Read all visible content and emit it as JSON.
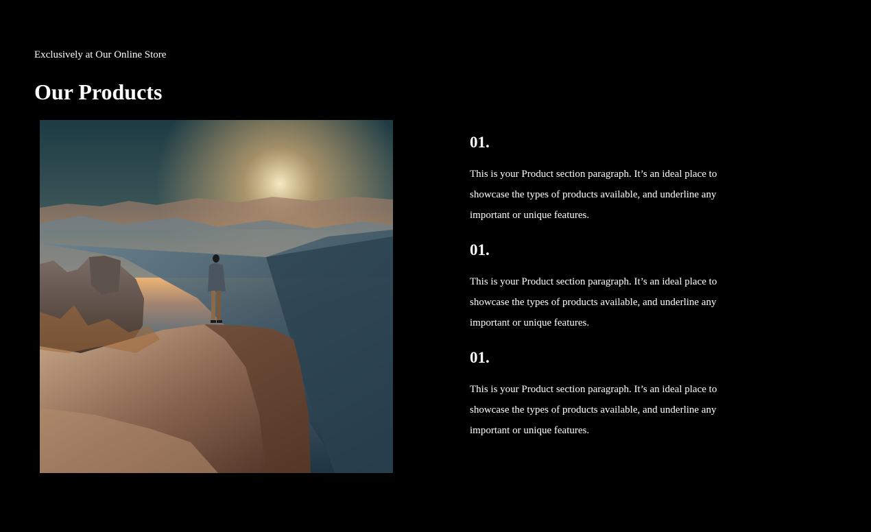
{
  "header": {
    "eyebrow": "Exclusively at Our Online Store",
    "title": "Our Products"
  },
  "image": {
    "description_icon": "mountain-hiker-photo"
  },
  "products": [
    {
      "number": "01.",
      "text": "This is your Product section paragraph. It’s an ideal place to showcase the types of products available, and underline any important or unique features."
    },
    {
      "number": "01.",
      "text": "This is your Product section paragraph. It’s an ideal place to showcase the types of products available, and underline any important or unique features."
    },
    {
      "number": "01.",
      "text": "This is your Product section paragraph. It’s an ideal place to showcase the types of products available, and underline any important or unique features."
    }
  ],
  "colors": {
    "background": "#000000",
    "text": "#ffffff"
  }
}
